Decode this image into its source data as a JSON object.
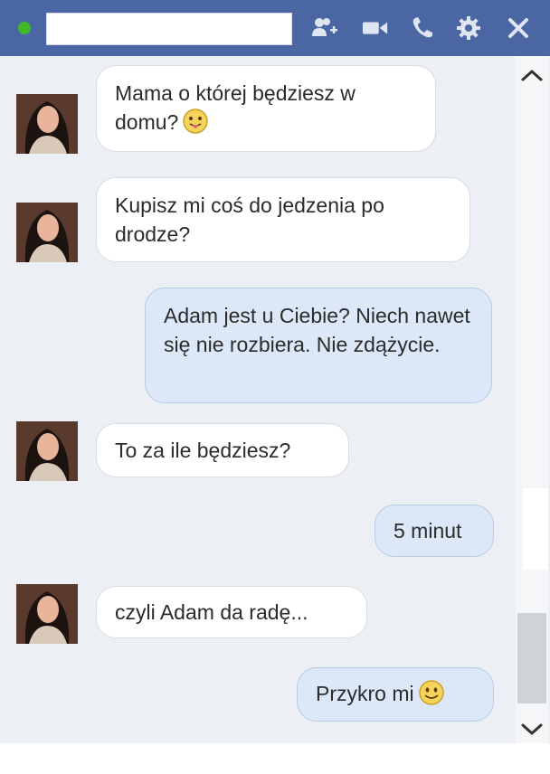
{
  "header": {
    "contact_name": "",
    "icons": [
      "add-friend-icon",
      "video-call-icon",
      "phone-icon",
      "gear-icon",
      "close-icon"
    ],
    "status_color": "#42b72a",
    "bar_color": "#4a67a4"
  },
  "messages": [
    {
      "direction": "incoming",
      "text": "Mama o której będziesz w domu?",
      "emoji": "tongue-emoji"
    },
    {
      "direction": "incoming",
      "text": "Kupisz mi coś do jedzenia po drodze?"
    },
    {
      "direction": "outgoing",
      "text": "Adam jest u Ciebie? Niech nawet się nie rozbiera. Nie zdążycie."
    },
    {
      "direction": "incoming",
      "text": "To za ile będziesz?"
    },
    {
      "direction": "outgoing",
      "text": "5 minut"
    },
    {
      "direction": "incoming",
      "text": "czyli Adam da radę..."
    },
    {
      "direction": "outgoing",
      "text": "Przykro mi",
      "emoji": "smile-emoji"
    }
  ]
}
